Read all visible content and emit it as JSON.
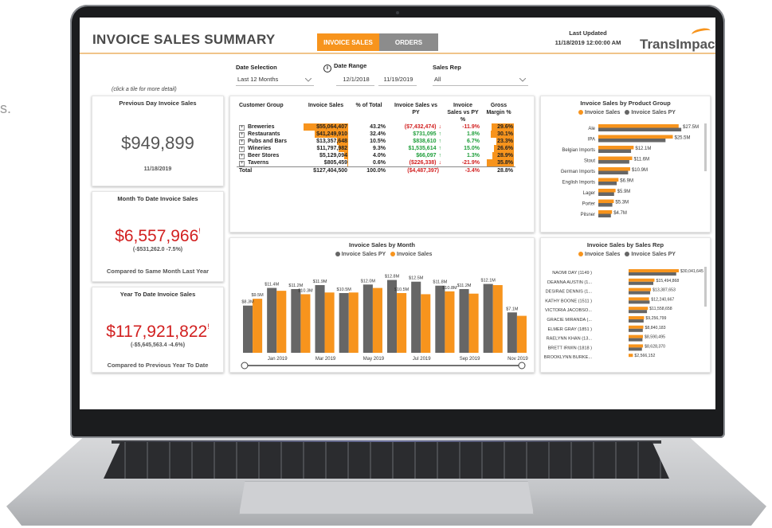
{
  "stray_text": "s.",
  "header": {
    "title": "INVOICE SALES SUMMARY",
    "tabs": [
      "INVOICE SALES",
      "ORDERS"
    ],
    "last_updated_label": "Last Updated",
    "last_updated_value": "11/18/2019 12:00:00 AM",
    "logo": "TransImpact"
  },
  "filters": {
    "date_selection_label": "Date Selection",
    "date_selection_value": "Last 12 Months",
    "date_range_label": "Date Range",
    "date_from": "12/1/2018",
    "date_to": "11/19/2019",
    "sales_rep_label": "Sales Rep",
    "sales_rep_value": "All",
    "info_icon": "i"
  },
  "hint": "(click a tile for more detail)",
  "kpis": {
    "prev_day": {
      "title": "Previous Day Invoice Sales",
      "value": "$949,899",
      "date": "11/18/2019"
    },
    "mtd": {
      "title": "Month To Date Invoice Sales",
      "value": "$6,557,966",
      "delta": "(-$531,262.0 -7.5%)",
      "compare": "Compared to Same Month Last Year"
    },
    "ytd": {
      "title": "Year To Date Invoice Sales",
      "value": "$117,921,822",
      "delta": "(-$5,645,563.4 -4.6%)",
      "compare": "Compared to Previous Year To Date"
    },
    "alert_glyph": "!"
  },
  "customer_table": {
    "headers": [
      "Customer Group",
      "Invoice Sales",
      "% of Total",
      "Invoice Sales vs PY",
      "Invoice Sales vs PY %",
      "Gross Margin %"
    ],
    "rows": [
      {
        "group": "Breweries",
        "sales": "$55,064,407",
        "share": 43.2,
        "pct_total": "43.2%",
        "vs_py": "($7,432,474)",
        "vs_py_pct": "-11.9%",
        "margin": "29.6%",
        "margin_val": 29.6,
        "trend": "down"
      },
      {
        "group": "Restaurants",
        "sales": "$41,249,910",
        "share": 32.4,
        "pct_total": "32.4%",
        "vs_py": "$731,095",
        "vs_py_pct": "1.8%",
        "margin": "30.1%",
        "margin_val": 30.1,
        "trend": "up"
      },
      {
        "group": "Pubs and Bars",
        "sales": "$13,357,648",
        "share": 10.5,
        "pct_total": "10.5%",
        "vs_py": "$838,610",
        "vs_py_pct": "6.7%",
        "margin": "23.3%",
        "margin_val": 23.3,
        "trend": "up"
      },
      {
        "group": "Wineries",
        "sales": "$11,797,982",
        "share": 9.3,
        "pct_total": "9.3%",
        "vs_py": "$1,535,614",
        "vs_py_pct": "15.0%",
        "margin": "26.6%",
        "margin_val": 26.6,
        "trend": "up"
      },
      {
        "group": "Beer Stores",
        "sales": "$5,129,094",
        "share": 4.0,
        "pct_total": "4.0%",
        "vs_py": "$66,097",
        "vs_py_pct": "1.3%",
        "margin": "28.9%",
        "margin_val": 28.9,
        "trend": "up"
      },
      {
        "group": "Taverns",
        "sales": "$805,459",
        "share": 0.6,
        "pct_total": "0.6%",
        "vs_py": "($226,338)",
        "vs_py_pct": "-21.9%",
        "margin": "35.8%",
        "margin_val": 35.8,
        "trend": "down"
      }
    ],
    "total": {
      "group": "Total",
      "sales": "$127,404,500",
      "pct_total": "100.0%",
      "vs_py": "($4,487,397)",
      "vs_py_pct": "-3.4%",
      "margin": "28.8%",
      "trend": "down"
    },
    "expand_glyph": "+",
    "up_arrow": "↑",
    "down_arrow": "↓"
  },
  "colors": {
    "accent": "#f7941d",
    "py": "#666666",
    "positive": "#1e9e3a",
    "negative": "#d22020"
  },
  "chart_data": [
    {
      "type": "bar",
      "title": "Invoice Sales by Product Group",
      "legend": [
        "Invoice Sales",
        "Invoice Sales PY"
      ],
      "categories": [
        "Ale",
        "IPA",
        "Belgian Imports",
        "Stout",
        "German Imports",
        "English Imports",
        "Lager",
        "Porter",
        "Pilsner"
      ],
      "series": [
        {
          "name": "Invoice Sales",
          "values": [
            27.5,
            25.5,
            12.1,
            11.6,
            10.9,
            6.9,
            5.9,
            5.3,
            4.7
          ]
        },
        {
          "name": "Invoice Sales PY",
          "values": [
            28.4,
            23.0,
            11.2,
            10.6,
            10.2,
            6.3,
            5.4,
            4.8,
            4.3
          ]
        }
      ],
      "value_labels": [
        "$27.5M",
        "$25.5M",
        "$12.1M",
        "$11.6M",
        "$10.9M",
        "$6.9M",
        "$5.9M",
        "$5.3M",
        "$4.7M"
      ],
      "xlim": [
        0,
        30
      ],
      "legend_position": "top"
    },
    {
      "type": "bar",
      "title": "Invoice Sales by Month",
      "legend": [
        "Invoice Sales PY",
        "Invoice Sales"
      ],
      "categories": [
        "Dec 2018",
        "Jan 2019",
        "Feb 2019",
        "Mar 2019",
        "Apr 2019",
        "May 2019",
        "Jun 2019",
        "Jul 2019",
        "Aug 2019",
        "Sep 2019",
        "Oct 2019",
        "Nov 2019"
      ],
      "x_tick_labels": [
        "Jan 2019",
        "Mar 2019",
        "May 2019",
        "Jul 2019",
        "Sep 2019",
        "Nov 2019"
      ],
      "series": [
        {
          "name": "Invoice Sales PY",
          "values": [
            8.3,
            11.4,
            11.2,
            11.9,
            10.5,
            12.0,
            12.8,
            12.5,
            11.8,
            11.2,
            12.1,
            7.1
          ]
        },
        {
          "name": "Invoice Sales",
          "values": [
            9.5,
            10.9,
            10.3,
            10.6,
            10.6,
            11.4,
            10.5,
            10.3,
            10.8,
            10.4,
            11.9,
            6.5
          ]
        }
      ],
      "value_labels": [
        "$8.3M",
        "$11.4M",
        "$11.2M",
        "$11.9M",
        "$10.5M",
        "$12.0M",
        "$12.8M",
        "$12.5M",
        "$11.8M",
        "$11.2M",
        "$12.1M",
        "$7.1M"
      ],
      "current_labels": [
        "$9.5M",
        "",
        "$10.3M",
        "",
        "",
        "",
        "$10.5M",
        "",
        "$10.8M",
        "",
        "",
        ""
      ],
      "ylim": [
        0,
        14
      ],
      "legend_position": "top"
    },
    {
      "type": "bar",
      "title": "Invoice Sales by Sales Rep",
      "legend": [
        "Invoice Sales",
        "Invoice Sales PY"
      ],
      "categories": [
        "NAOMI DAY (1149 )",
        "DEANNA AUSTIN (1...",
        "DESIRAE DENNIS (1...",
        "KATHY BOONE (1511 )",
        "VICTORIA JACOBSO...",
        "GRACIE MIRANDA (...",
        "ELMER GRAY (1851 )",
        "RAELYNN KHAN (13...",
        "BRETT IRWIN (1818 )",
        "BROOKLYNN BURKE..."
      ],
      "series": [
        {
          "name": "Invoice Sales",
          "values": [
            30.04,
            15.49,
            13.39,
            12.24,
            11.56,
            9.26,
            8.84,
            8.59,
            8.63,
            2.57
          ]
        },
        {
          "name": "Invoice Sales PY",
          "values": [
            28.5,
            14.8,
            12.9,
            12.6,
            11.0,
            9.0,
            8.5,
            8.3,
            8.0,
            0.0
          ]
        }
      ],
      "value_labels": [
        "$30,041,645",
        "$15,494,868",
        "$13,387,653",
        "$12,240,667",
        "$11,558,658",
        "$9,256,799",
        "$8,840,183",
        "$8,590,495",
        "$8,628,370",
        "$2,566,152"
      ],
      "xlim": [
        0,
        31
      ],
      "legend_position": "top"
    }
  ]
}
